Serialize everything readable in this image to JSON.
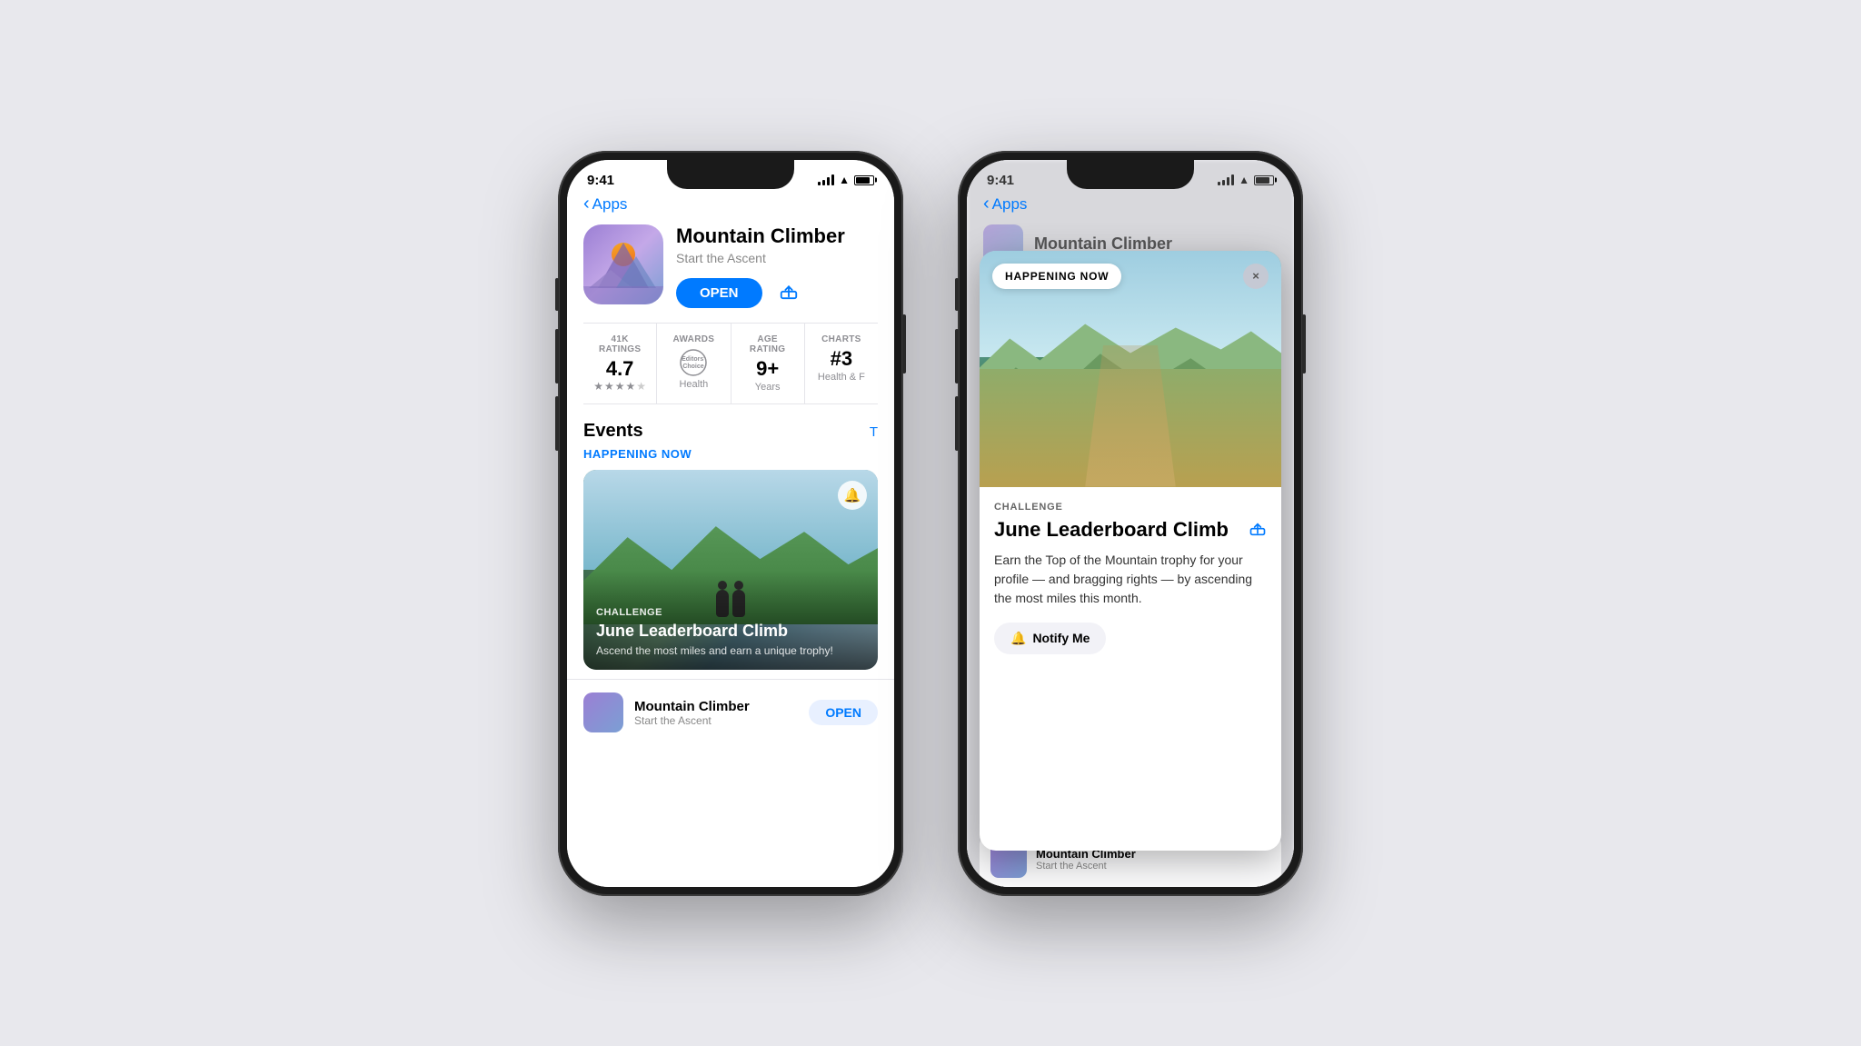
{
  "background": "#e8e8ed",
  "phone1": {
    "statusBar": {
      "time": "9:41",
      "signal": true,
      "wifi": true,
      "battery": true
    },
    "navBack": "Apps",
    "appName": "Mountain Climber",
    "appSubtitle": "Start the Ascent",
    "openButton": "OPEN",
    "ratings": {
      "count": "41K RATINGS",
      "value": "4.7",
      "awardsLabel": "AWARDS",
      "awardsValue": "Editors' Choice",
      "awardsSub": "Health",
      "ageRatingLabel": "AGE RATING",
      "ageRatingValue": "9+",
      "ageRatingSub": "Years",
      "chartsLabel": "CHARTS",
      "chartsValue": "#3",
      "chartsSub": "Health & F"
    },
    "eventsSection": {
      "title": "Events",
      "link": "T",
      "happeningNow": "HAPPENING NOW",
      "eventCard": {
        "type": "CHALLENGE",
        "title": "June Leaderboard Climb",
        "desc": "Ascend the most miles and earn a unique trophy!"
      }
    },
    "miniCard": {
      "name": "Mountain Climber",
      "subtitle": "Start the Ascent",
      "openButton": "OPEN"
    }
  },
  "phone2": {
    "statusBar": {
      "time": "9:41"
    },
    "navBack": "Apps",
    "appName": "Mountain Climber",
    "happeningBadge": "HAPPENING NOW",
    "closeButton": "×",
    "modal": {
      "type": "CHALLENGE",
      "title": "June Leaderboard Climb",
      "desc": "Earn the Top of the Mountain trophy for your profile — and bragging rights — by ascending the most miles this month.",
      "notifyButton": "Notify Me"
    },
    "bottomCard": {
      "name": "Mountain Climber",
      "subtitle": "Start the Ascent"
    }
  }
}
